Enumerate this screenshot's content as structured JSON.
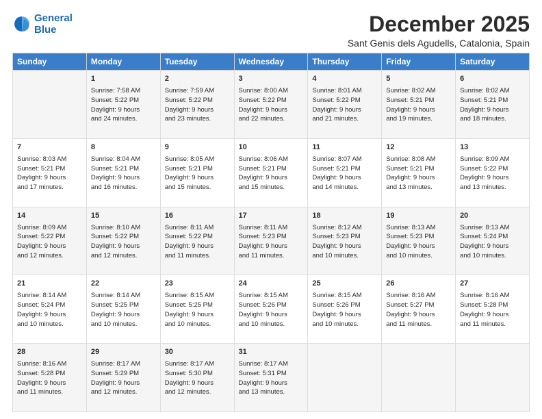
{
  "logo": {
    "line1": "General",
    "line2": "Blue"
  },
  "title": "December 2025",
  "subtitle": "Sant Genis dels Agudells, Catalonia, Spain",
  "columns": [
    "Sunday",
    "Monday",
    "Tuesday",
    "Wednesday",
    "Thursday",
    "Friday",
    "Saturday"
  ],
  "weeks": [
    [
      {
        "day": "",
        "text": ""
      },
      {
        "day": "1",
        "text": "Sunrise: 7:58 AM\nSunset: 5:22 PM\nDaylight: 9 hours\nand 24 minutes."
      },
      {
        "day": "2",
        "text": "Sunrise: 7:59 AM\nSunset: 5:22 PM\nDaylight: 9 hours\nand 23 minutes."
      },
      {
        "day": "3",
        "text": "Sunrise: 8:00 AM\nSunset: 5:22 PM\nDaylight: 9 hours\nand 22 minutes."
      },
      {
        "day": "4",
        "text": "Sunrise: 8:01 AM\nSunset: 5:22 PM\nDaylight: 9 hours\nand 21 minutes."
      },
      {
        "day": "5",
        "text": "Sunrise: 8:02 AM\nSunset: 5:21 PM\nDaylight: 9 hours\nand 19 minutes."
      },
      {
        "day": "6",
        "text": "Sunrise: 8:02 AM\nSunset: 5:21 PM\nDaylight: 9 hours\nand 18 minutes."
      }
    ],
    [
      {
        "day": "7",
        "text": "Sunrise: 8:03 AM\nSunset: 5:21 PM\nDaylight: 9 hours\nand 17 minutes."
      },
      {
        "day": "8",
        "text": "Sunrise: 8:04 AM\nSunset: 5:21 PM\nDaylight: 9 hours\nand 16 minutes."
      },
      {
        "day": "9",
        "text": "Sunrise: 8:05 AM\nSunset: 5:21 PM\nDaylight: 9 hours\nand 15 minutes."
      },
      {
        "day": "10",
        "text": "Sunrise: 8:06 AM\nSunset: 5:21 PM\nDaylight: 9 hours\nand 15 minutes."
      },
      {
        "day": "11",
        "text": "Sunrise: 8:07 AM\nSunset: 5:21 PM\nDaylight: 9 hours\nand 14 minutes."
      },
      {
        "day": "12",
        "text": "Sunrise: 8:08 AM\nSunset: 5:21 PM\nDaylight: 9 hours\nand 13 minutes."
      },
      {
        "day": "13",
        "text": "Sunrise: 8:09 AM\nSunset: 5:22 PM\nDaylight: 9 hours\nand 13 minutes."
      }
    ],
    [
      {
        "day": "14",
        "text": "Sunrise: 8:09 AM\nSunset: 5:22 PM\nDaylight: 9 hours\nand 12 minutes."
      },
      {
        "day": "15",
        "text": "Sunrise: 8:10 AM\nSunset: 5:22 PM\nDaylight: 9 hours\nand 12 minutes."
      },
      {
        "day": "16",
        "text": "Sunrise: 8:11 AM\nSunset: 5:22 PM\nDaylight: 9 hours\nand 11 minutes."
      },
      {
        "day": "17",
        "text": "Sunrise: 8:11 AM\nSunset: 5:23 PM\nDaylight: 9 hours\nand 11 minutes."
      },
      {
        "day": "18",
        "text": "Sunrise: 8:12 AM\nSunset: 5:23 PM\nDaylight: 9 hours\nand 10 minutes."
      },
      {
        "day": "19",
        "text": "Sunrise: 8:13 AM\nSunset: 5:23 PM\nDaylight: 9 hours\nand 10 minutes."
      },
      {
        "day": "20",
        "text": "Sunrise: 8:13 AM\nSunset: 5:24 PM\nDaylight: 9 hours\nand 10 minutes."
      }
    ],
    [
      {
        "day": "21",
        "text": "Sunrise: 8:14 AM\nSunset: 5:24 PM\nDaylight: 9 hours\nand 10 minutes."
      },
      {
        "day": "22",
        "text": "Sunrise: 8:14 AM\nSunset: 5:25 PM\nDaylight: 9 hours\nand 10 minutes."
      },
      {
        "day": "23",
        "text": "Sunrise: 8:15 AM\nSunset: 5:25 PM\nDaylight: 9 hours\nand 10 minutes."
      },
      {
        "day": "24",
        "text": "Sunrise: 8:15 AM\nSunset: 5:26 PM\nDaylight: 9 hours\nand 10 minutes."
      },
      {
        "day": "25",
        "text": "Sunrise: 8:15 AM\nSunset: 5:26 PM\nDaylight: 9 hours\nand 10 minutes."
      },
      {
        "day": "26",
        "text": "Sunrise: 8:16 AM\nSunset: 5:27 PM\nDaylight: 9 hours\nand 11 minutes."
      },
      {
        "day": "27",
        "text": "Sunrise: 8:16 AM\nSunset: 5:28 PM\nDaylight: 9 hours\nand 11 minutes."
      }
    ],
    [
      {
        "day": "28",
        "text": "Sunrise: 8:16 AM\nSunset: 5:28 PM\nDaylight: 9 hours\nand 11 minutes."
      },
      {
        "day": "29",
        "text": "Sunrise: 8:17 AM\nSunset: 5:29 PM\nDaylight: 9 hours\nand 12 minutes."
      },
      {
        "day": "30",
        "text": "Sunrise: 8:17 AM\nSunset: 5:30 PM\nDaylight: 9 hours\nand 12 minutes."
      },
      {
        "day": "31",
        "text": "Sunrise: 8:17 AM\nSunset: 5:31 PM\nDaylight: 9 hours\nand 13 minutes."
      },
      {
        "day": "",
        "text": ""
      },
      {
        "day": "",
        "text": ""
      },
      {
        "day": "",
        "text": ""
      }
    ]
  ]
}
